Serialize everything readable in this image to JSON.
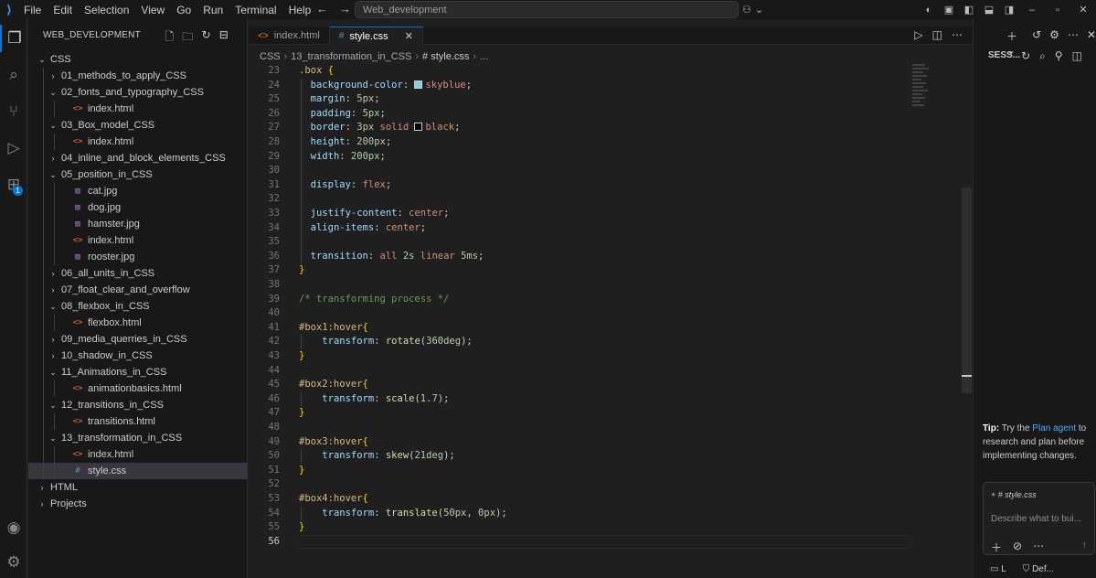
{
  "titlebar": {
    "menu": [
      "File",
      "Edit",
      "Selection",
      "View",
      "Go",
      "Run",
      "Terminal",
      "Help"
    ],
    "search": "Web_development"
  },
  "sidebar": {
    "title": "WEB_DEVELOPMENT",
    "tree": [
      {
        "label": "CSS",
        "type": "folder-open",
        "depth": 0
      },
      {
        "label": "01_methods_to_apply_CSS",
        "type": "folder",
        "depth": 1
      },
      {
        "label": "02_fonts_and_typography_CSS",
        "type": "folder-open",
        "depth": 1
      },
      {
        "label": "index.html",
        "type": "html",
        "depth": 2
      },
      {
        "label": "03_Box_model_CSS",
        "type": "folder-open",
        "depth": 1
      },
      {
        "label": "index.html",
        "type": "html",
        "depth": 2
      },
      {
        "label": "04_inline_and_block_elements_CSS",
        "type": "folder",
        "depth": 1
      },
      {
        "label": "05_position_in_CSS",
        "type": "folder-open",
        "depth": 1
      },
      {
        "label": "cat.jpg",
        "type": "img",
        "depth": 2
      },
      {
        "label": "dog.jpg",
        "type": "img",
        "depth": 2
      },
      {
        "label": "hamster.jpg",
        "type": "img",
        "depth": 2
      },
      {
        "label": "index.html",
        "type": "html",
        "depth": 2
      },
      {
        "label": "rooster.jpg",
        "type": "img",
        "depth": 2
      },
      {
        "label": "06_all_units_in_CSS",
        "type": "folder",
        "depth": 1
      },
      {
        "label": "07_float_clear_and_overflow",
        "type": "folder",
        "depth": 1
      },
      {
        "label": "08_flexbox_in_CSS",
        "type": "folder-open",
        "depth": 1
      },
      {
        "label": "flexbox.html",
        "type": "html",
        "depth": 2
      },
      {
        "label": "09_media_querries_in_CSS",
        "type": "folder",
        "depth": 1
      },
      {
        "label": "10_shadow_in_CSS",
        "type": "folder",
        "depth": 1
      },
      {
        "label": "11_Animations_in_CSS",
        "type": "folder-open",
        "depth": 1
      },
      {
        "label": "animationbasics.html",
        "type": "html",
        "depth": 2
      },
      {
        "label": "12_transitions_in_CSS",
        "type": "folder-open",
        "depth": 1
      },
      {
        "label": "transitions.html",
        "type": "html",
        "depth": 2
      },
      {
        "label": "13_transformation_in_CSS",
        "type": "folder-open",
        "depth": 1
      },
      {
        "label": "index.html",
        "type": "html",
        "depth": 2
      },
      {
        "label": "style.css",
        "type": "css",
        "depth": 2,
        "selected": true
      },
      {
        "label": "HTML",
        "type": "folder",
        "depth": 0
      },
      {
        "label": "Projects",
        "type": "folder",
        "depth": 0
      }
    ]
  },
  "tabs": [
    {
      "label": "index.html",
      "icon": "<>",
      "active": false
    },
    {
      "label": "style.css",
      "icon": "#",
      "active": true
    }
  ],
  "breadcrumb": [
    "CSS",
    "13_transformation_in_CSS",
    "# style.css",
    "..."
  ],
  "code": [
    {
      "n": "23",
      "parts": [
        [
          "sel",
          ".box "
        ],
        [
          "br",
          "{"
        ]
      ]
    },
    {
      "n": "24",
      "parts": [
        [
          "pun",
          "  "
        ],
        [
          "prop",
          "background-color"
        ],
        [
          "pun",
          ": "
        ],
        [
          "swatch",
          "#87ceeb"
        ],
        [
          "val",
          "skyblue"
        ],
        [
          "pun",
          ";"
        ]
      ]
    },
    {
      "n": "25",
      "parts": [
        [
          "pun",
          "  "
        ],
        [
          "prop",
          "margin"
        ],
        [
          "pun",
          ": "
        ],
        [
          "num",
          "5px"
        ],
        [
          "pun",
          ";"
        ]
      ]
    },
    {
      "n": "26",
      "parts": [
        [
          "pun",
          "  "
        ],
        [
          "prop",
          "padding"
        ],
        [
          "pun",
          ": "
        ],
        [
          "num",
          "5px"
        ],
        [
          "pun",
          ";"
        ]
      ]
    },
    {
      "n": "27",
      "parts": [
        [
          "pun",
          "  "
        ],
        [
          "prop",
          "border"
        ],
        [
          "pun",
          ": "
        ],
        [
          "num",
          "3px"
        ],
        [
          "val",
          " solid "
        ],
        [
          "swatch",
          "#000000"
        ],
        [
          "val",
          "black"
        ],
        [
          "pun",
          ";"
        ]
      ]
    },
    {
      "n": "28",
      "parts": [
        [
          "pun",
          "  "
        ],
        [
          "prop",
          "height"
        ],
        [
          "pun",
          ": "
        ],
        [
          "num",
          "200px"
        ],
        [
          "pun",
          ";"
        ]
      ]
    },
    {
      "n": "29",
      "parts": [
        [
          "pun",
          "  "
        ],
        [
          "prop",
          "width"
        ],
        [
          "pun",
          ": "
        ],
        [
          "num",
          "200px"
        ],
        [
          "pun",
          ";"
        ]
      ]
    },
    {
      "n": "30",
      "parts": []
    },
    {
      "n": "31",
      "parts": [
        [
          "pun",
          "  "
        ],
        [
          "prop",
          "display"
        ],
        [
          "pun",
          ": "
        ],
        [
          "val",
          "flex"
        ],
        [
          "pun",
          ";"
        ]
      ]
    },
    {
      "n": "32",
      "parts": []
    },
    {
      "n": "33",
      "parts": [
        [
          "pun",
          "  "
        ],
        [
          "prop",
          "justify-content"
        ],
        [
          "pun",
          ": "
        ],
        [
          "val",
          "center"
        ],
        [
          "pun",
          ";"
        ]
      ]
    },
    {
      "n": "34",
      "parts": [
        [
          "pun",
          "  "
        ],
        [
          "prop",
          "align-items"
        ],
        [
          "pun",
          ": "
        ],
        [
          "val",
          "center"
        ],
        [
          "pun",
          ";"
        ]
      ]
    },
    {
      "n": "35",
      "parts": []
    },
    {
      "n": "36",
      "parts": [
        [
          "pun",
          "  "
        ],
        [
          "prop",
          "transition"
        ],
        [
          "pun",
          ": "
        ],
        [
          "val",
          "all "
        ],
        [
          "num",
          "2s"
        ],
        [
          "val",
          " linear "
        ],
        [
          "num",
          "5ms"
        ],
        [
          "pun",
          ";"
        ]
      ]
    },
    {
      "n": "37",
      "parts": [
        [
          "br",
          "}"
        ]
      ]
    },
    {
      "n": "38",
      "parts": []
    },
    {
      "n": "39",
      "parts": [
        [
          "cmt",
          "/* transforming process */"
        ]
      ]
    },
    {
      "n": "40",
      "parts": []
    },
    {
      "n": "41",
      "parts": [
        [
          "sel",
          "#box1:hover"
        ],
        [
          "br",
          "{"
        ]
      ]
    },
    {
      "n": "42",
      "parts": [
        [
          "pun",
          "    "
        ],
        [
          "prop",
          "transform"
        ],
        [
          "pun",
          ": "
        ],
        [
          "fn",
          "rotate"
        ],
        [
          "pun",
          "("
        ],
        [
          "num",
          "360deg"
        ],
        [
          "pun",
          ");"
        ]
      ]
    },
    {
      "n": "43",
      "parts": [
        [
          "br",
          "}"
        ]
      ]
    },
    {
      "n": "44",
      "parts": []
    },
    {
      "n": "45",
      "parts": [
        [
          "sel",
          "#box2:hover"
        ],
        [
          "br",
          "{"
        ]
      ]
    },
    {
      "n": "46",
      "parts": [
        [
          "pun",
          "    "
        ],
        [
          "prop",
          "transform"
        ],
        [
          "pun",
          ": "
        ],
        [
          "fn",
          "scale"
        ],
        [
          "pun",
          "("
        ],
        [
          "num",
          "1.7"
        ],
        [
          "pun",
          ");"
        ]
      ]
    },
    {
      "n": "47",
      "parts": [
        [
          "br",
          "}"
        ]
      ]
    },
    {
      "n": "48",
      "parts": []
    },
    {
      "n": "49",
      "parts": [
        [
          "sel",
          "#box3:hover"
        ],
        [
          "br",
          "{"
        ]
      ]
    },
    {
      "n": "50",
      "parts": [
        [
          "pun",
          "    "
        ],
        [
          "prop",
          "transform"
        ],
        [
          "pun",
          ": "
        ],
        [
          "fn",
          "skew"
        ],
        [
          "pun",
          "("
        ],
        [
          "num",
          "21deg"
        ],
        [
          "pun",
          ");"
        ]
      ]
    },
    {
      "n": "51",
      "parts": [
        [
          "br",
          "}"
        ]
      ]
    },
    {
      "n": "52",
      "parts": []
    },
    {
      "n": "53",
      "parts": [
        [
          "sel",
          "#box4:hover"
        ],
        [
          "br",
          "{"
        ]
      ]
    },
    {
      "n": "54",
      "parts": [
        [
          "pun",
          "    "
        ],
        [
          "prop",
          "transform"
        ],
        [
          "pun",
          ": "
        ],
        [
          "fn",
          "translate"
        ],
        [
          "pun",
          "("
        ],
        [
          "num",
          "50px"
        ],
        [
          "pun",
          ", "
        ],
        [
          "num",
          "0px"
        ],
        [
          "pun",
          ");"
        ]
      ]
    },
    {
      "n": "55",
      "parts": [
        [
          "br",
          "}"
        ]
      ]
    },
    {
      "n": "56",
      "parts": [],
      "current": true
    }
  ],
  "chat": {
    "title": "SESS...",
    "tip_label": "Tip:",
    "tip_pre": "Try the",
    "tip_link": "Plan agent",
    "tip_post": "to research and plan before implementing changes.",
    "context_chip": "style.css",
    "placeholder": "Describe what to bui...",
    "bottom_left": "L",
    "bottom_right": "Def..."
  },
  "colors": {
    "accent": "#0078d4",
    "html_icon": "#e37933",
    "css_icon": "#519aba"
  }
}
